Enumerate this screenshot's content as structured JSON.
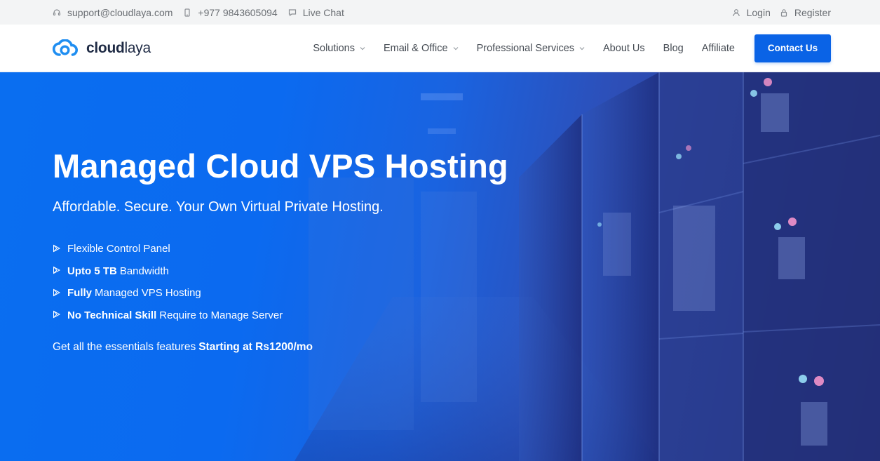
{
  "topbar": {
    "email": "support@cloudlaya.com",
    "phone": "+977 9843605094",
    "chat": "Live Chat",
    "login": "Login",
    "register": "Register"
  },
  "header": {
    "logo_bold": "cloud",
    "logo_light": "laya",
    "nav": [
      {
        "label": "Solutions",
        "dropdown": true
      },
      {
        "label": "Email & Office",
        "dropdown": true
      },
      {
        "label": "Professional Services",
        "dropdown": true
      },
      {
        "label": "About Us",
        "dropdown": false
      },
      {
        "label": "Blog",
        "dropdown": false
      },
      {
        "label": "Affiliate",
        "dropdown": false
      }
    ],
    "contact_label": "Contact Us"
  },
  "hero": {
    "title": "Managed Cloud VPS Hosting",
    "subtitle": "Affordable. Secure. Your Own Virtual Private Hosting.",
    "features": [
      {
        "bold": "",
        "text": "Flexible Control Panel"
      },
      {
        "bold": "Upto 5 TB",
        "text": "Bandwidth"
      },
      {
        "bold": "Fully",
        "text": "Managed VPS Hosting"
      },
      {
        "bold": "No Technical Skill",
        "text": "Require to Manage Server"
      }
    ],
    "pricing_text": "Get all the essentials features",
    "pricing_bold": "Starting at Rs1200/mo"
  },
  "icons": {
    "headset": "headset-icon",
    "phone": "phone-icon",
    "chat": "chat-icon",
    "user": "user-icon",
    "lock": "lock-icon",
    "feature": "play-outline-icon"
  },
  "colors": {
    "accent": "#0a63e6",
    "hero_start": "#0a6ef0",
    "hero_end": "#2a2a6e",
    "topbar_bg": "#f3f4f5",
    "text_dark": "#444a52"
  }
}
